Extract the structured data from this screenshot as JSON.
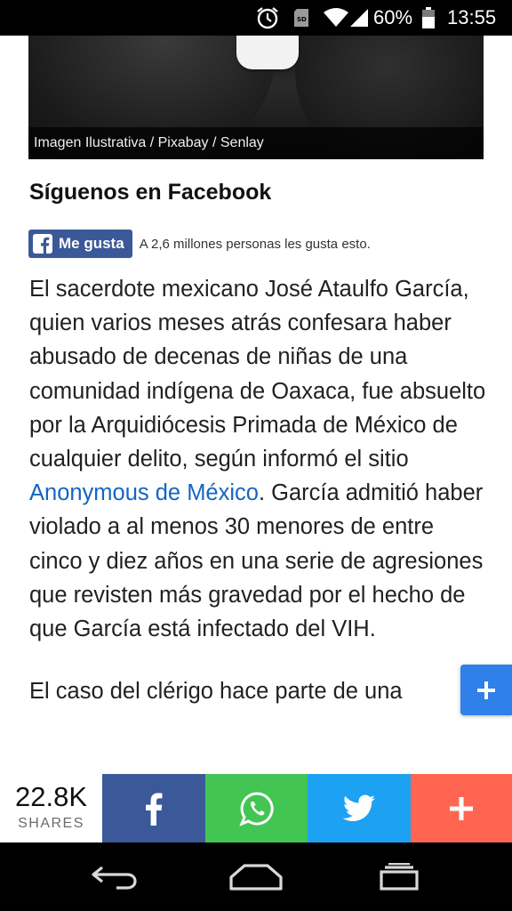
{
  "status_bar": {
    "battery_percent": "60%",
    "time": "13:55",
    "icons": [
      "alarm-icon",
      "sd-card-icon",
      "wifi-icon",
      "signal-icon",
      "battery-icon"
    ]
  },
  "hero": {
    "caption": "Imagen Ilustrativa  /  Pixabay / Senlay"
  },
  "follow": {
    "title": "Síguenos en Facebook",
    "like_label": "Me gusta",
    "like_count_text": "A 2,6 millones personas les gusta esto."
  },
  "article": {
    "p1_before_link": "El sacerdote mexicano José Ataulfo García, quien varios meses atrás confesara haber abusado de decenas de niñas de una comunidad indígena de Oaxaca, fue absuelto por la Arquidiócesis Primada de México de cualquier delito, según informó el sitio ",
    "p1_link": "Anonymous de México",
    "p1_after_link": ". García admitió haber violado a al menos 30 menores de entre cinco y diez años en una serie de agresiones que revisten más gravedad por el hecho de que García está infectado del VIH.",
    "p2": "El caso del clérigo hace parte de una"
  },
  "share_bar": {
    "count": "22.8K",
    "count_label": "SHARES",
    "buttons": [
      "facebook-icon",
      "whatsapp-icon",
      "twitter-icon",
      "plus-icon"
    ],
    "colors": {
      "facebook": "#3b5998",
      "whatsapp": "#43c553",
      "twitter": "#1da1f2",
      "more": "#ff6550"
    }
  },
  "fab": {
    "icon": "plus-icon",
    "color": "#2f80e8"
  },
  "nav_bar": {
    "buttons": [
      "back-icon",
      "home-icon",
      "recent-apps-icon"
    ]
  },
  "colors": {
    "link": "#1565c0",
    "facebook_blue": "#3b5998"
  }
}
